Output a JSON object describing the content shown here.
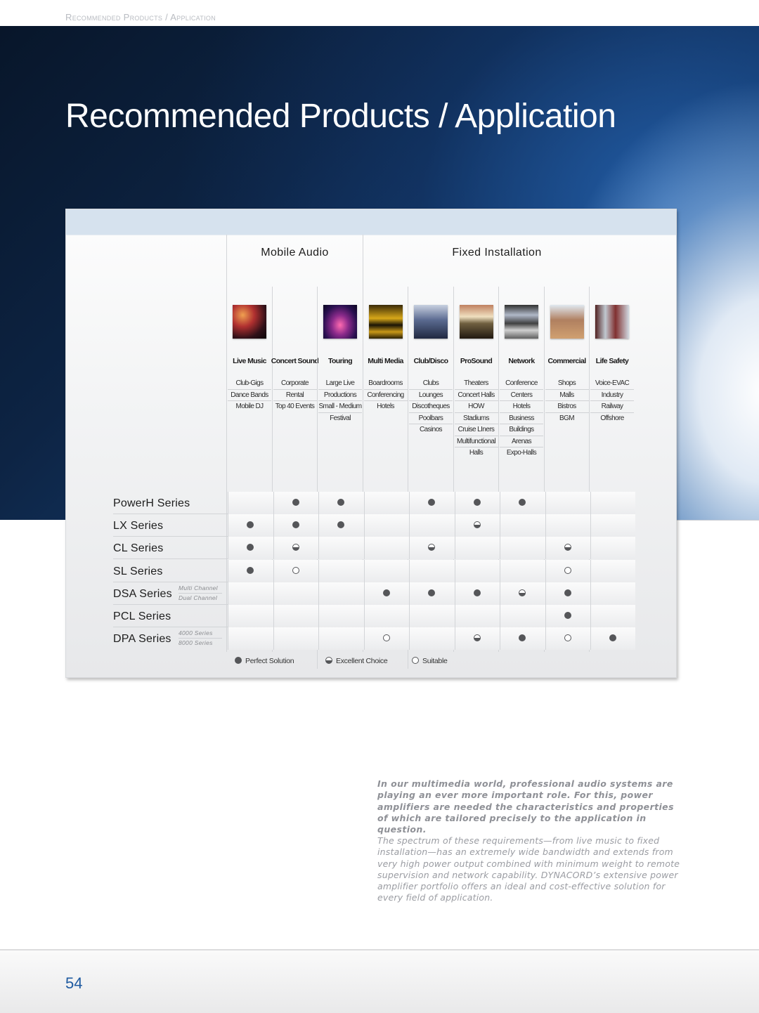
{
  "running_head": "Recommended Products / Application",
  "page_title": "Recommended Products / Application",
  "matrix": {
    "groups": [
      {
        "label": "Mobile Audio"
      },
      {
        "label": "Fixed Installation"
      }
    ],
    "columns": [
      {
        "title": "Live Music",
        "thumb": "live-music-photo",
        "items": [
          "Club-Gigs",
          "Dance Bands",
          "Mobile DJ"
        ]
      },
      {
        "title": "Concert Sound",
        "thumb": "",
        "items": [
          "Corporate",
          "Rental",
          "Top 40 Events"
        ]
      },
      {
        "title": "Touring",
        "thumb": "touring-photo",
        "items": [
          "Large Live",
          "Productions",
          "Small - Medium",
          "Festival"
        ]
      },
      {
        "title": "Multi Media",
        "thumb": "multi-media-photo",
        "items": [
          "Boardrooms",
          "Conferencing",
          "Hotels"
        ]
      },
      {
        "title": "Club/Disco",
        "thumb": "club-disco-photo",
        "items": [
          "Clubs",
          "Lounges",
          "Discotheques",
          "Poolbars",
          "Casinos"
        ]
      },
      {
        "title": "ProSound",
        "thumb": "prosound-photo",
        "items": [
          "Theaters",
          "Concert Halls",
          "HOW",
          "Stadiums",
          "Cruise LIners",
          "Multifunctional",
          "Halls"
        ]
      },
      {
        "title": "Network",
        "thumb": "network-photo",
        "items": [
          "Conference",
          "Centers",
          "Hotels",
          "Business",
          "Buildings",
          "Arenas",
          "Expo-Halls"
        ]
      },
      {
        "title": "Commercial",
        "thumb": "commercial-photo",
        "items": [
          "Shops",
          "Malls",
          "Bistros",
          "BGM"
        ]
      },
      {
        "title": "Life Safety",
        "thumb": "life-safety-photo",
        "items": [
          "Voice-EVAC",
          "Industry",
          "Railway",
          "Offshore"
        ]
      }
    ],
    "rows": [
      {
        "name": "PowerH Series",
        "subs": [],
        "ratings": [
          "",
          "perfect",
          "perfect",
          "",
          "perfect",
          "perfect",
          "perfect",
          "",
          ""
        ]
      },
      {
        "name": "LX Series",
        "subs": [],
        "ratings": [
          "perfect",
          "perfect",
          "perfect",
          "",
          "",
          "excellent",
          "",
          "",
          ""
        ]
      },
      {
        "name": "CL Series",
        "subs": [],
        "ratings": [
          "perfect",
          "excellent",
          "",
          "",
          "excellent",
          "",
          "",
          "excellent",
          ""
        ]
      },
      {
        "name": "SL Series",
        "subs": [],
        "ratings": [
          "perfect",
          "suitable",
          "",
          "",
          "",
          "",
          "",
          "suitable",
          ""
        ]
      },
      {
        "name": "DSA Series",
        "subs": [
          "Multi Channel",
          "Dual Channel"
        ],
        "ratings": [
          "",
          "",
          "",
          "perfect",
          "perfect",
          "perfect",
          "excellent",
          "perfect",
          ""
        ]
      },
      {
        "name": "PCL Series",
        "subs": [],
        "ratings": [
          "",
          "",
          "",
          "",
          "",
          "",
          "",
          "perfect",
          ""
        ]
      },
      {
        "name": "DPA Series",
        "subs": [
          "4000 Series",
          "8000 Series"
        ],
        "ratings": [
          "",
          "",
          "",
          "suitable",
          "",
          "excellent",
          "perfect",
          "suitable",
          "perfect"
        ]
      }
    ],
    "legend": [
      {
        "key": "perfect",
        "label": "Perfect Solution"
      },
      {
        "key": "excellent",
        "label": "Excellent Choice"
      },
      {
        "key": "suitable",
        "label": "Suitable"
      }
    ]
  },
  "intro_text": "In our multimedia world, professional audio systems are playing an ever more important role. For this, power amplifiers are needed the characteristics and properties of which are tailored precisely to the application in question.",
  "body_text": "The spectrum of these requirements—from live music to fixed installation—has an extremely wide bandwidth and extends from very high power output combined with minimum weight to remote supervision and network capability. DYNACORD’s extensive power amplifier portfolio offers an ideal and cost-effective solution for every field of application.",
  "page_number": "54",
  "colors": {
    "accent": "#1e5aa0",
    "dot": "#555659",
    "panel_band": "#d6e2ee"
  }
}
